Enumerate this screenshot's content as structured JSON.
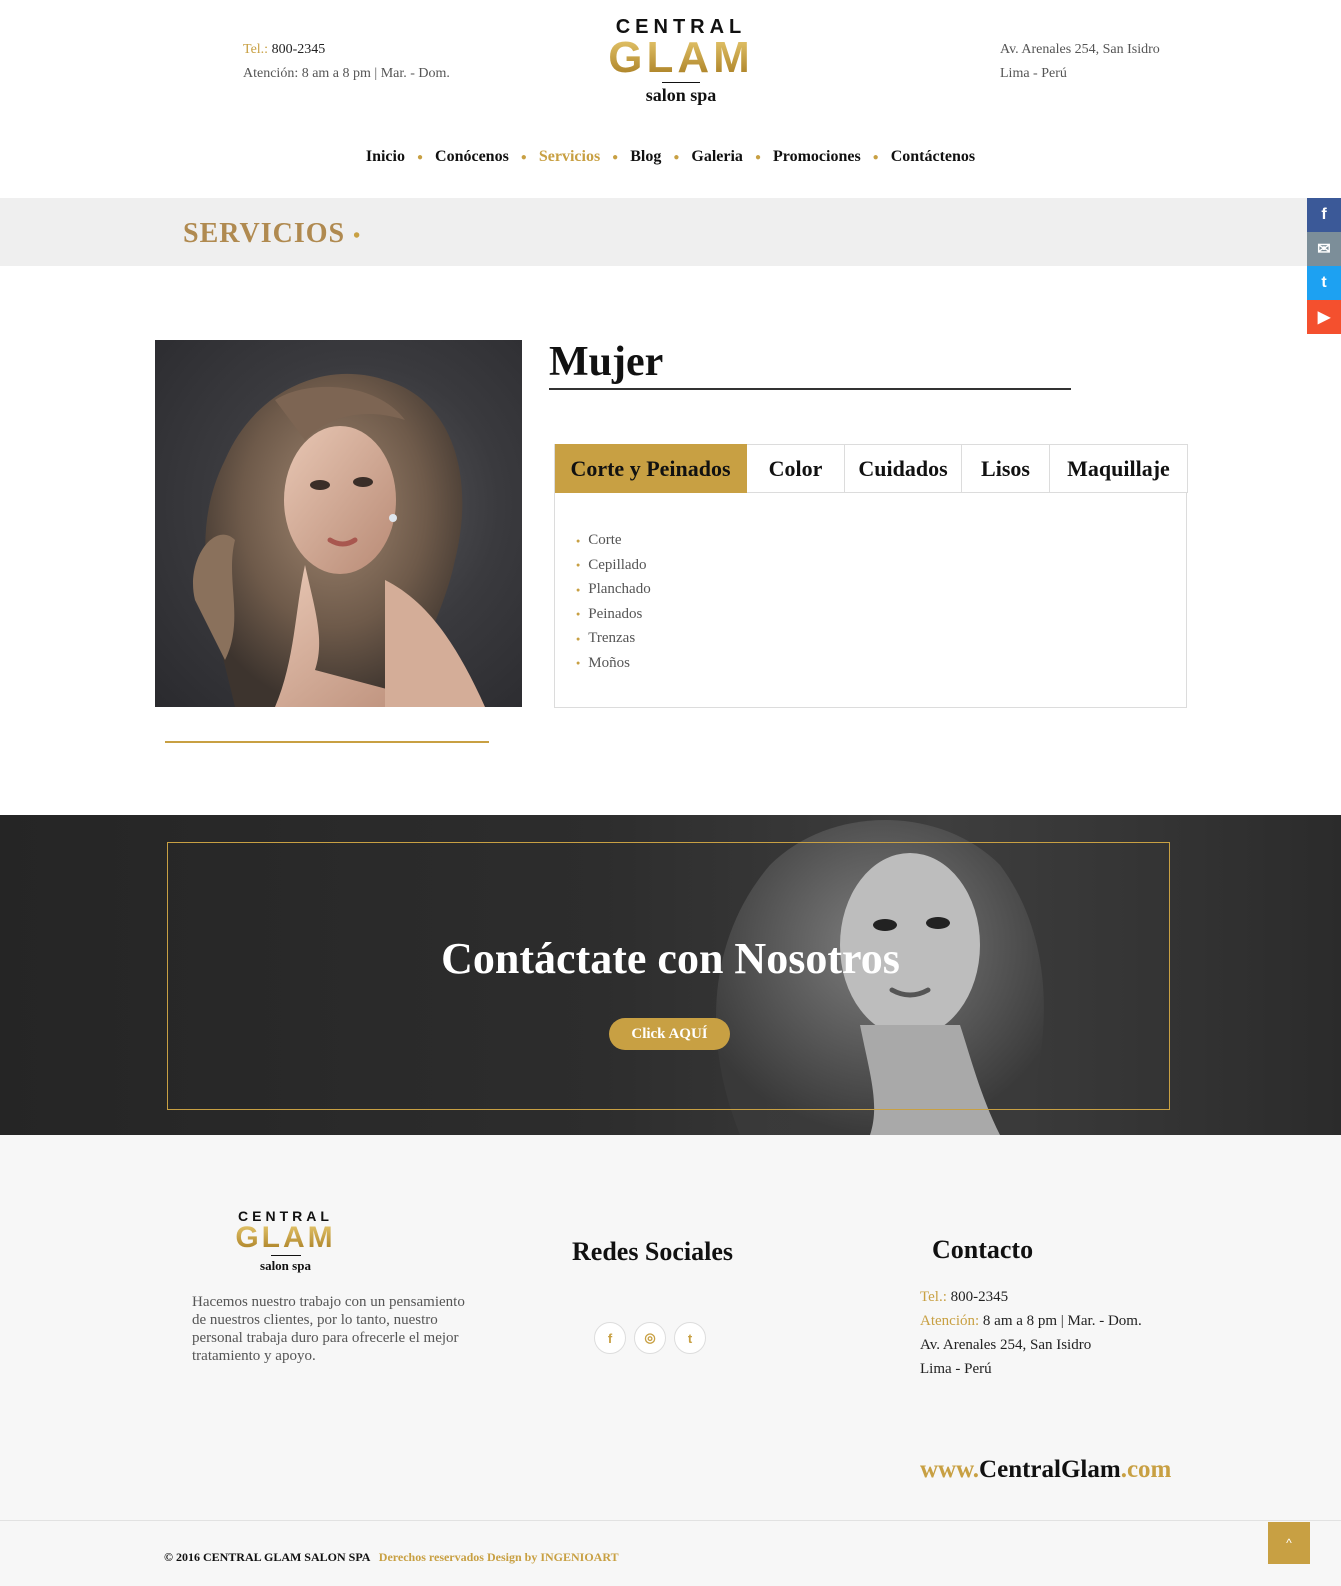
{
  "header": {
    "tel_label": "Tel.:",
    "tel_value": "800-2345",
    "hours": "Atención: 8 am a 8 pm  |  Mar. - Dom.",
    "address_line1": "Av. Arenales  254, San Isidro",
    "address_line2": "Lima - Perú"
  },
  "logo": {
    "line1": "CENTRAL",
    "line2": "GLAM",
    "line3": "salon spa"
  },
  "nav": {
    "items": [
      "Inicio",
      "Conócenos",
      "Servicios",
      "Blog",
      "Galeria",
      "Promociones",
      "Contáctenos"
    ],
    "active": "Servicios"
  },
  "banner": {
    "title": "SERVICIOS",
    "dot": "•"
  },
  "social_side": {
    "facebook": "f",
    "mail": "✉",
    "twitter": "t",
    "youtube": "▶"
  },
  "category": {
    "title": "Mujer",
    "tabs": [
      "Corte y Peinados",
      "Color",
      "Cuidados",
      "Lisos",
      "Maquillaje"
    ],
    "active_tab": "Corte y Peinados",
    "items": [
      "Corte",
      "Cepillado",
      "Planchado",
      "Peinados",
      "Trenzas",
      "Moños"
    ]
  },
  "cta": {
    "title": "Contáctate con Nosotros",
    "button": "Click AQUÍ"
  },
  "footer": {
    "about": "Hacemos nuestro trabajo con un pensamiento de nuestros clientes, por lo tanto, nuestro personal trabaja duro para ofrecerle el mejor tratamiento y apoyo.",
    "social_heading": "Redes Sociales",
    "social_icons": [
      "f",
      "◎",
      "t"
    ],
    "contact_heading": "Contacto",
    "tel_label": "Tel.:",
    "tel_value": "800-2345",
    "hours_label": "Atención:",
    "hours_value": "8 am a 8 pm  |  Mar. - Dom.",
    "address_line1": "Av. Arenales  254, San Isidro",
    "address_line2": "Lima - Perú",
    "website_prefix": "www.",
    "website_main": "CentralGlam",
    "website_suffix": ".com",
    "copyright": "© 2016   CENTRAL GLAM SALON SPA",
    "credits": "Derechos reservados Design by INGENIOART",
    "to_top": "^"
  },
  "colors": {
    "accent": "#c8a043",
    "banner_bg": "#efefef",
    "cta_bg": "#2b2b2b",
    "footer_bg": "#f7f7f7"
  }
}
